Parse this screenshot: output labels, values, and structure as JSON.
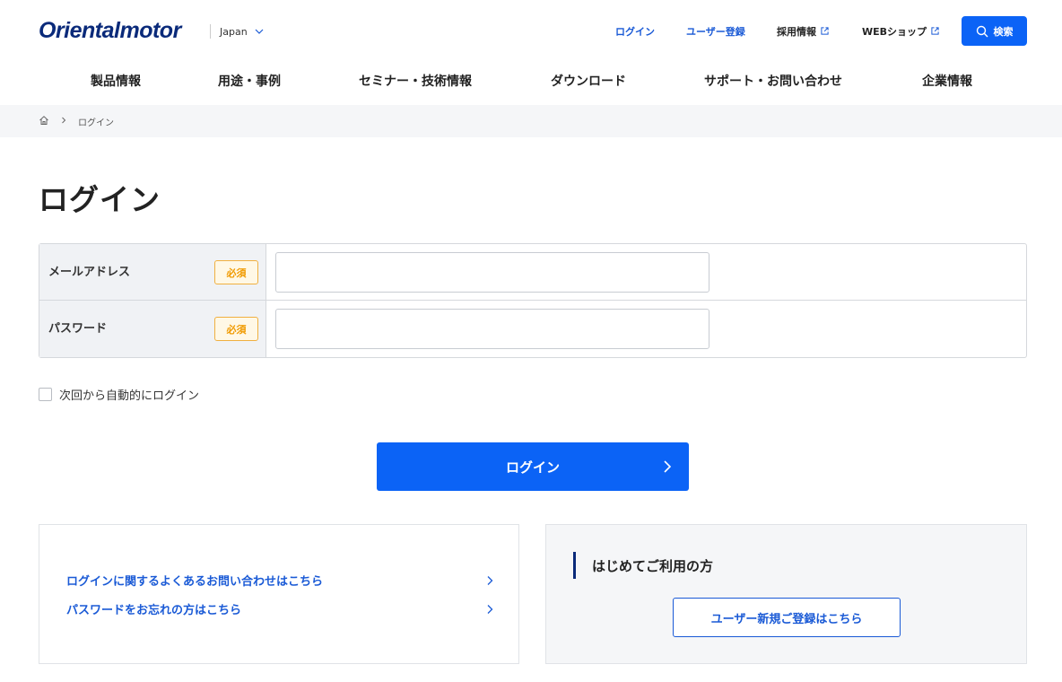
{
  "header": {
    "logo": "Orientalmotor",
    "region": "Japan",
    "util_links": {
      "login": "ログイン",
      "register": "ユーザー登録",
      "careers": "採用情報",
      "webshop": "WEBショップ"
    },
    "search_label": "検索"
  },
  "gnav": {
    "items": [
      "製品情報",
      "用途・事例",
      "セミナー・技術情報",
      "ダウンロード",
      "サポート・お問い合わせ",
      "企業情報"
    ]
  },
  "breadcrumb": {
    "current": "ログイン"
  },
  "page_title": "ログイン",
  "form": {
    "email_label": "メールアドレス",
    "password_label": "パスワード",
    "required_badge": "必須",
    "email_value": "",
    "password_value": ""
  },
  "remember_label": "次回から自動的にログイン",
  "login_button": "ログイン",
  "help_links": {
    "faq": "ログインに関するよくあるお問い合わせはこちら",
    "forgot": "パスワードをお忘れの方はこちら"
  },
  "first_time": {
    "heading": "はじめてご利用の方",
    "register_button": "ユーザー新規ご登録はこちら"
  },
  "colors": {
    "primary": "#0b63f6",
    "navy": "#0a2a7a",
    "link": "#1a5ad6",
    "required": "#f09a00"
  }
}
